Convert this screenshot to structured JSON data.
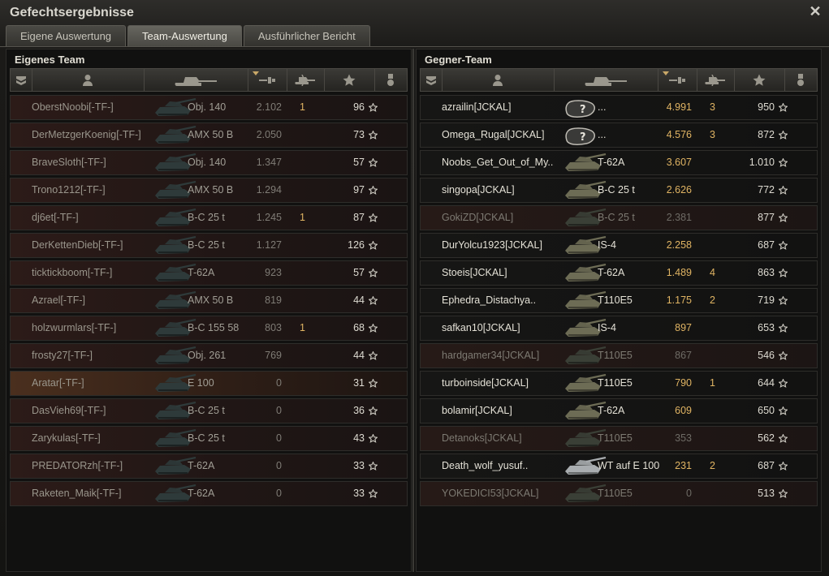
{
  "window": {
    "title": "Gefechtsergebnisse",
    "close_glyph": "✕"
  },
  "tabs": [
    {
      "label": "Eigene Auswertung",
      "active": false
    },
    {
      "label": "Team-Auswertung",
      "active": true
    },
    {
      "label": "Ausführlicher Bericht",
      "active": false
    }
  ],
  "columns": [
    "rank-icon",
    "player-icon",
    "vehicle-icon",
    "damage-icon",
    "kills-icon",
    "xp-star-icon",
    "medal-icon"
  ],
  "own_team": {
    "title": "Eigenes Team",
    "rows": [
      {
        "player": "OberstNoobi[-TF-]",
        "vehicle": "Obj. 140",
        "damage": "2.102",
        "kills": "1",
        "xp": "96",
        "state": "dead"
      },
      {
        "player": "DerMetzgerKoenig[-TF-]",
        "vehicle": "AMX 50 B",
        "damage": "2.050",
        "kills": "",
        "xp": "73",
        "state": "dead"
      },
      {
        "player": "BraveSloth[-TF-]",
        "vehicle": "Obj. 140",
        "damage": "1.347",
        "kills": "",
        "xp": "57",
        "state": "dead"
      },
      {
        "player": "Trono1212[-TF-]",
        "vehicle": "AMX 50 B",
        "damage": "1.294",
        "kills": "",
        "xp": "97",
        "state": "dead"
      },
      {
        "player": "dj6et[-TF-]",
        "vehicle": "B-C 25 t",
        "damage": "1.245",
        "kills": "1",
        "xp": "87",
        "state": "dead"
      },
      {
        "player": "DerKettenDieb[-TF-]",
        "vehicle": "B-C 25 t",
        "damage": "1.127",
        "kills": "",
        "xp": "126",
        "state": "dead"
      },
      {
        "player": "ticktickboom[-TF-]",
        "vehicle": "T-62A",
        "damage": "923",
        "kills": "",
        "xp": "57",
        "state": "dead"
      },
      {
        "player": "Azrael[-TF-]",
        "vehicle": "AMX 50 B",
        "damage": "819",
        "kills": "",
        "xp": "44",
        "state": "dead"
      },
      {
        "player": "holzwurmlars[-TF-]",
        "vehicle": "B-C 155 58",
        "damage": "803",
        "kills": "1",
        "xp": "68",
        "state": "dead"
      },
      {
        "player": "frosty27[-TF-]",
        "vehicle": "Obj. 261",
        "damage": "769",
        "kills": "",
        "xp": "44",
        "state": "dead"
      },
      {
        "player": "Aratar[-TF-]",
        "vehicle": "E 100",
        "damage": "0",
        "kills": "",
        "xp": "31",
        "state": "highlight"
      },
      {
        "player": "DasVieh69[-TF-]",
        "vehicle": "B-C 25 t",
        "damage": "0",
        "kills": "",
        "xp": "36",
        "state": "dead"
      },
      {
        "player": "Zarykulas[-TF-]",
        "vehicle": "B-C 25 t",
        "damage": "0",
        "kills": "",
        "xp": "43",
        "state": "dead"
      },
      {
        "player": "PREDATORzh[-TF-]",
        "vehicle": "T-62A",
        "damage": "0",
        "kills": "",
        "xp": "33",
        "state": "dead"
      },
      {
        "player": "Raketen_Maik[-TF-]",
        "vehicle": "T-62A",
        "damage": "0",
        "kills": "",
        "xp": "33",
        "state": "dead"
      }
    ]
  },
  "enemy_team": {
    "title": "Gegner-Team",
    "rows": [
      {
        "player": "azrailin[JCKAL]",
        "vehicle": "...",
        "damage": "4.991",
        "kills": "3",
        "xp": "950",
        "state": "alive",
        "unknown": true
      },
      {
        "player": "Omega_Rugal[JCKAL]",
        "vehicle": "...",
        "damage": "4.576",
        "kills": "3",
        "xp": "872",
        "state": "alive",
        "unknown": true
      },
      {
        "player": "Noobs_Get_Out_of_My..",
        "vehicle": "T-62A",
        "damage": "3.607",
        "kills": "",
        "xp": "1.010",
        "state": "alive"
      },
      {
        "player": "singopa[JCKAL]",
        "vehicle": "B-C 25 t",
        "damage": "2.626",
        "kills": "",
        "xp": "772",
        "state": "alive"
      },
      {
        "player": "GokiZD[JCKAL]",
        "vehicle": "B-C 25 t",
        "damage": "2.381",
        "kills": "",
        "xp": "877",
        "state": "dead"
      },
      {
        "player": "DurYolcu1923[JCKAL]",
        "vehicle": "IS-4",
        "damage": "2.258",
        "kills": "",
        "xp": "687",
        "state": "alive"
      },
      {
        "player": "Stoeis[JCKAL]",
        "vehicle": "T-62A",
        "damage": "1.489",
        "kills": "4",
        "xp": "863",
        "state": "alive"
      },
      {
        "player": "Ephedra_Distachya..",
        "vehicle": "T110E5",
        "damage": "1.175",
        "kills": "2",
        "xp": "719",
        "state": "alive"
      },
      {
        "player": "safkan10[JCKAL]",
        "vehicle": "IS-4",
        "damage": "897",
        "kills": "",
        "xp": "653",
        "state": "alive"
      },
      {
        "player": "hardgamer34[JCKAL]",
        "vehicle": "T110E5",
        "damage": "867",
        "kills": "",
        "xp": "546",
        "state": "dead"
      },
      {
        "player": "turboinside[JCKAL]",
        "vehicle": "T110E5",
        "damage": "790",
        "kills": "1",
        "xp": "644",
        "state": "alive"
      },
      {
        "player": "bolamir[JCKAL]",
        "vehicle": "T-62A",
        "damage": "609",
        "kills": "",
        "xp": "650",
        "state": "alive"
      },
      {
        "player": "Detanoks[JCKAL]",
        "vehicle": "T110E5",
        "damage": "353",
        "kills": "",
        "xp": "562",
        "state": "dead"
      },
      {
        "player": "Death_wolf_yusuf..",
        "vehicle": "WT auf E 100",
        "damage": "231",
        "kills": "2",
        "xp": "687",
        "state": "alive",
        "special": true
      },
      {
        "player": "YOKEDICI53[JCKAL]",
        "vehicle": "T110E5",
        "damage": "0",
        "kills": "",
        "xp": "513",
        "state": "dead"
      }
    ]
  }
}
